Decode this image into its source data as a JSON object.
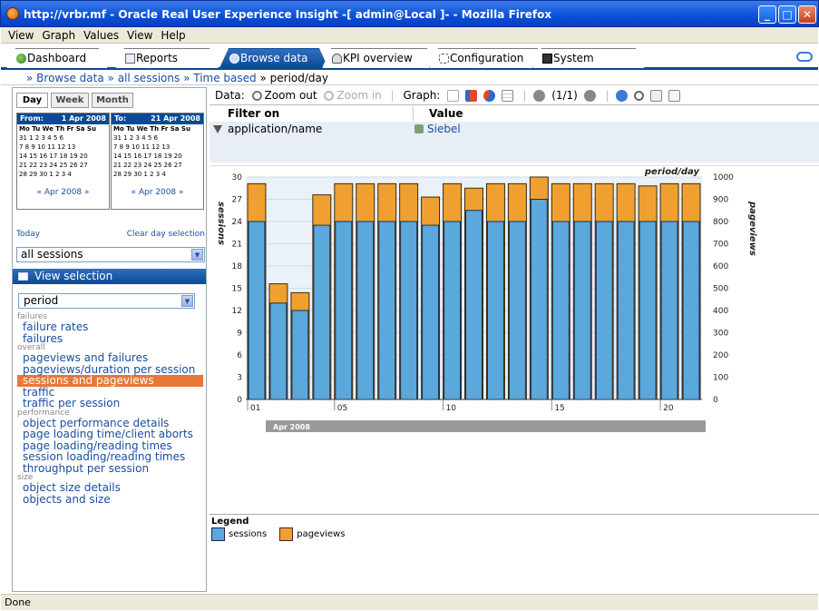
{
  "window": {
    "title": "http://vrbr.mf - Oracle Real User Experience Insight -[ admin@Local ]- - Mozilla Firefox",
    "min_glyph": "_",
    "max_glyph": "□",
    "close_glyph": "✕"
  },
  "menubar": [
    "View",
    "Graph",
    "Values",
    "View",
    "Help"
  ],
  "tabs": [
    {
      "label": "Dashboard",
      "icon": "globe-icon"
    },
    {
      "label": "Reports",
      "icon": "report-icon"
    },
    {
      "label": "Browse data",
      "icon": "browse-icon",
      "active": true
    },
    {
      "label": "KPI overview",
      "icon": "gauge-icon"
    },
    {
      "label": "Configuration",
      "icon": "config-icon"
    },
    {
      "label": "System",
      "icon": "system-icon"
    }
  ],
  "breadcrumb": {
    "sep": "»",
    "items": [
      "Browse data",
      "all sessions",
      "Time based"
    ],
    "current": "period/day"
  },
  "date_tabs": [
    "Day",
    "Week",
    "Month"
  ],
  "calendar_from": {
    "label": "From:",
    "date": "1 Apr 2008",
    "dow": "Mo Tu We Th Fr Sa Su",
    "weeks": [
      "31 1 2 3 4 5 6",
      "7 8 9 10 11 12 13",
      "14 15 16 17 18 19 20",
      "21 22 23 24 25 26 27",
      "28 29 30 1 2 3 4"
    ],
    "nav": "« Apr 2008 »"
  },
  "calendar_to": {
    "label": "To:",
    "date": "21 Apr 2008",
    "dow": "Mo Tu We Th Fr Sa Su",
    "weeks": [
      "31 1 2 3 4 5 6",
      "7 8 9 10 11 12 13",
      "14 15 16 17 18 19 20",
      "21 22 23 24 25 26 27",
      "28 29 30 1 2 3 4"
    ],
    "nav": "« Apr 2008 »"
  },
  "today_link": "Today",
  "clear_link": "Clear day selection",
  "session_select": "all sessions",
  "view_selection_title": "View selection",
  "period_select": "period",
  "nav_groups": [
    {
      "title": "failures",
      "items": [
        "failure rates",
        "failures"
      ]
    },
    {
      "title": "overall",
      "items": [
        "pageviews and failures",
        "pageviews/duration per session",
        "sessions and pageviews",
        "traffic",
        "traffic per session"
      ]
    },
    {
      "title": "performance",
      "items": [
        "object performance details",
        "page loading time/client aborts",
        "page loading/reading times",
        "session loading/reading times",
        "throughput per session"
      ]
    },
    {
      "title": "size",
      "items": [
        "object size details",
        "objects and size"
      ]
    }
  ],
  "selected_nav": "sessions and pageviews",
  "toolbar": {
    "data_label": "Data:",
    "zoom_out": "Zoom out",
    "zoom_in": "Zoom in",
    "graph_label": "Graph:",
    "page": "(1/1)"
  },
  "filter": {
    "col1": "Filter on",
    "col2": "Value",
    "key": "application/name",
    "value": "Siebel"
  },
  "legend": {
    "title": "Legend",
    "sessions": "sessions",
    "pageviews": "pageviews"
  },
  "status": "Done",
  "colors": {
    "sessions": "#5aa8dc",
    "pageviews": "#f0a030",
    "accent": "#0a4a96",
    "selected": "#e8773a"
  },
  "chart_data": {
    "type": "bar",
    "title": "period/day",
    "x": [
      1,
      2,
      3,
      4,
      5,
      6,
      7,
      8,
      9,
      10,
      11,
      12,
      13,
      14,
      15,
      16,
      17,
      18,
      19,
      20,
      21
    ],
    "x_ticks": [
      "01",
      "05",
      "10",
      "15",
      "20"
    ],
    "period_label": "Apr 2008",
    "left_axis": {
      "label": "sessions",
      "ticks": [
        0,
        3,
        6,
        9,
        12,
        15,
        18,
        21,
        24,
        27,
        30
      ],
      "ylim": [
        0,
        30
      ]
    },
    "right_axis": {
      "label": "pageviews",
      "ticks": [
        0,
        100,
        200,
        300,
        400,
        500,
        600,
        700,
        800,
        900,
        1000
      ],
      "ylim": [
        0,
        1000
      ]
    },
    "series": [
      {
        "name": "sessions",
        "axis": "left",
        "values": [
          24,
          13,
          12,
          23.5,
          24,
          24,
          24,
          24,
          23.5,
          24,
          25.5,
          24,
          24,
          27,
          24,
          24,
          24,
          24,
          24,
          24,
          24
        ]
      },
      {
        "name": "pageviews",
        "axis": "right",
        "values": [
          970,
          520,
          480,
          920,
          970,
          970,
          970,
          970,
          910,
          970,
          950,
          970,
          970,
          1000,
          970,
          970,
          970,
          970,
          960,
          970,
          970
        ]
      }
    ],
    "grid": true
  }
}
